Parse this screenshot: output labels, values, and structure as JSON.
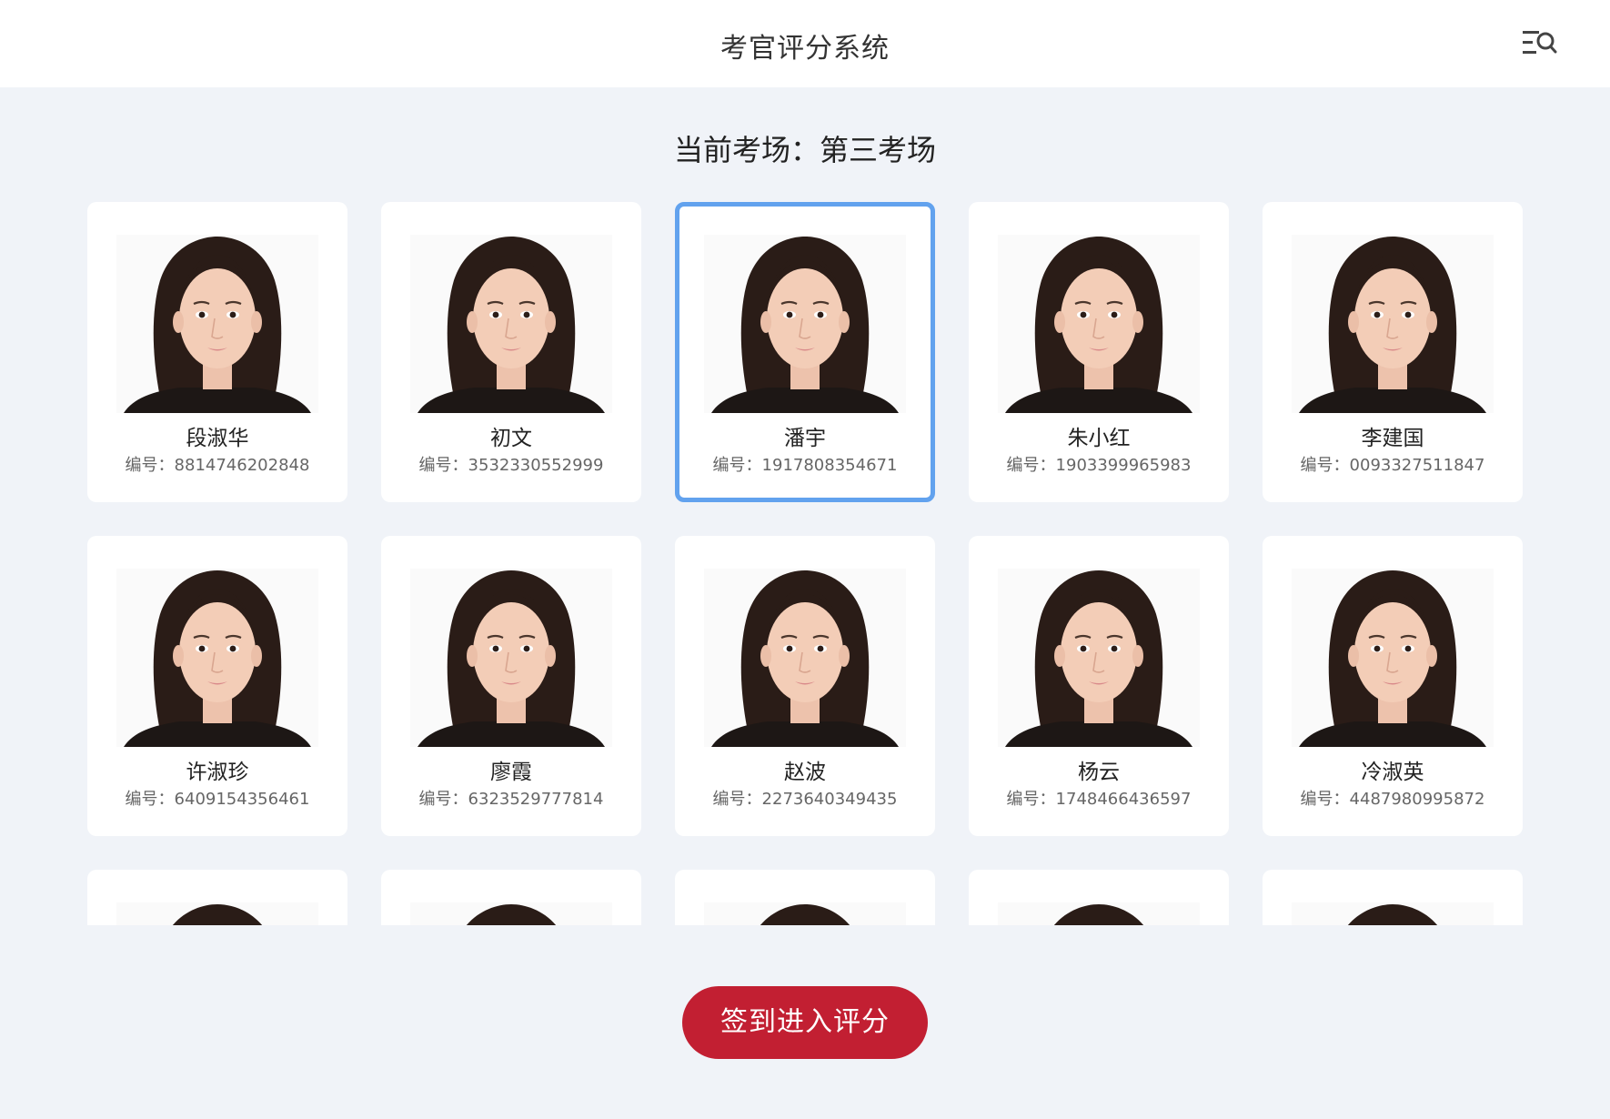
{
  "header": {
    "title": "考官评分系统",
    "menu_icon": "menu-search-icon"
  },
  "exam_room": {
    "text": "当前考场：第三考场"
  },
  "id_prefix": "编号：",
  "candidates": [
    {
      "name": "段淑华",
      "id_label": "编号：8814746202848",
      "selected": false
    },
    {
      "name": "初文",
      "id_label": "编号：3532330552999",
      "selected": false
    },
    {
      "name": "潘宇",
      "id_label": "编号：1917808354671",
      "selected": true
    },
    {
      "name": "朱小红",
      "id_label": "编号：1903399965983",
      "selected": false
    },
    {
      "name": "李建国",
      "id_label": "编号：0093327511847",
      "selected": false
    },
    {
      "name": "许淑珍",
      "id_label": "编号：6409154356461",
      "selected": false
    },
    {
      "name": "廖霞",
      "id_label": "编号：6323529777814",
      "selected": false
    },
    {
      "name": "赵波",
      "id_label": "编号：2273640349435",
      "selected": false
    },
    {
      "name": "杨云",
      "id_label": "编号：1748466436597",
      "selected": false
    },
    {
      "name": "冷淑英",
      "id_label": "编号：4487980995872",
      "selected": false
    }
  ],
  "partial_row_count": 5,
  "colors": {
    "background": "#f0f3f8",
    "selected_border": "#62a2ee",
    "primary_button": "#c21f32"
  },
  "footer": {
    "signin_label": "签到进入评分"
  }
}
